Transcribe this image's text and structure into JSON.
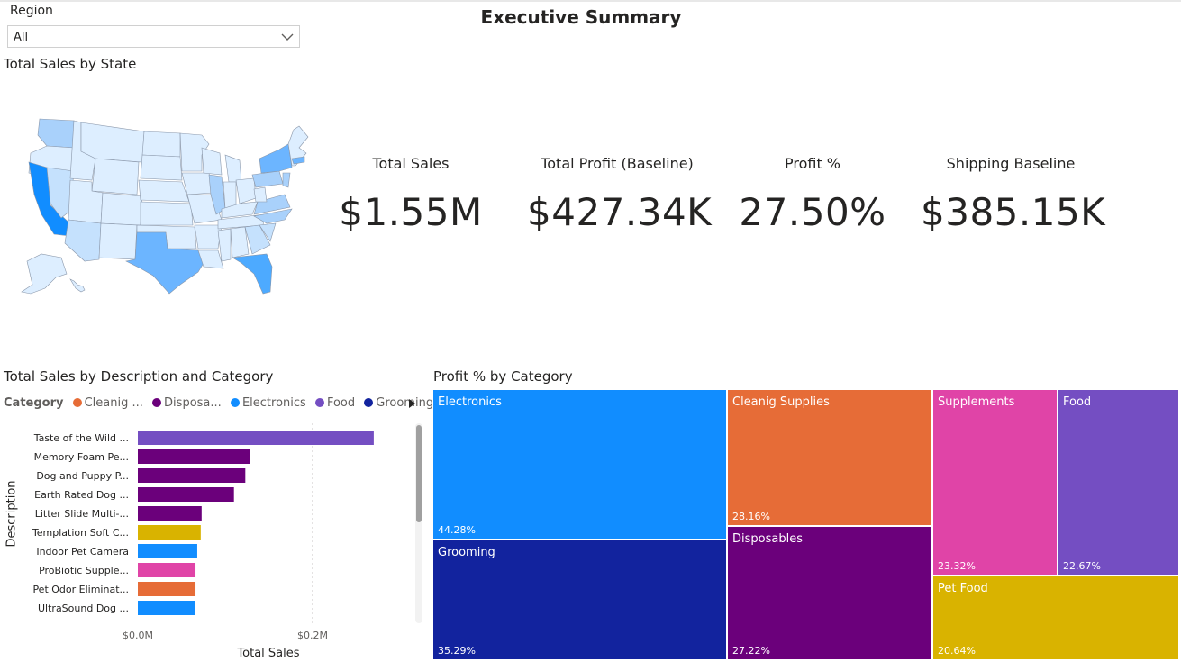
{
  "page_title": "Executive Summary",
  "slicer": {
    "label": "Region",
    "value": "All"
  },
  "map": {
    "title": "Total Sales by State",
    "colors": {
      "low": "#ddeeff",
      "mid": "#a9d1fb",
      "high": "#6cb5ff",
      "top": "#118dff",
      "border": "#7f8ea3"
    }
  },
  "kpis": [
    {
      "label": "Total Sales",
      "value": "$1.55M"
    },
    {
      "label": "Total Profit (Baseline)",
      "value": "$427.34K"
    },
    {
      "label": "Profit %",
      "value": "27.50%"
    },
    {
      "label": "Shipping Baseline",
      "value": "$385.15K"
    }
  ],
  "bar_visual": {
    "title": "Total Sales by Description and Category",
    "legend_label": "Category",
    "legend_items": [
      {
        "name": "Cleanig ...",
        "color": "#e66c37"
      },
      {
        "name": "Disposa...",
        "color": "#6b007b"
      },
      {
        "name": "Electronics",
        "color": "#118dff"
      },
      {
        "name": "Food",
        "color": "#744ec2"
      },
      {
        "name": "Grooming",
        "color": "#12239e"
      }
    ],
    "y_axis_title": "Description",
    "x_axis_title": "Total Sales",
    "x_ticks": [
      "$0.0M",
      "$0.2M"
    ]
  },
  "treemap_title": "Profit % by Category",
  "chart_data": [
    {
      "type": "bar",
      "orientation": "horizontal",
      "xlabel": "Total Sales",
      "ylabel": "Description",
      "xlim": [
        0,
        0.26
      ],
      "x_ticks": [
        "$0.0M",
        "$0.2M"
      ],
      "categories": [
        "Taste of the Wild ...",
        "Memory Foam Pe...",
        "Dog and Puppy P...",
        "Earth Rated Dog ...",
        "Litter Slide Multi-...",
        "Templation Soft C...",
        "Indoor Pet Camera",
        "ProBiotic Supple...",
        "Pet Odor Eliminat...",
        "UltraSound Dog ..."
      ],
      "values": [
        0.27,
        0.128,
        0.123,
        0.11,
        0.073,
        0.072,
        0.068,
        0.066,
        0.066,
        0.065
      ],
      "value_unit": "$M",
      "bar_colors": [
        "#744ec2",
        "#6b007b",
        "#6b007b",
        "#6b007b",
        "#6b007b",
        "#d9b300",
        "#118dff",
        "#e044a7",
        "#e66c37",
        "#118dff"
      ]
    },
    {
      "type": "treemap",
      "categories": [
        "Electronics",
        "Grooming",
        "Cleanig Supplies",
        "Disposables",
        "Supplements",
        "Food",
        "Pet Food"
      ],
      "values": [
        "44.28%",
        "35.29%",
        "28.16%",
        "27.22%",
        "23.32%",
        "22.67%",
        "20.64%"
      ],
      "colors": [
        "#118dff",
        "#12239e",
        "#e66c37",
        "#6b007b",
        "#e044a7",
        "#744ec2",
        "#d9b300"
      ]
    }
  ]
}
